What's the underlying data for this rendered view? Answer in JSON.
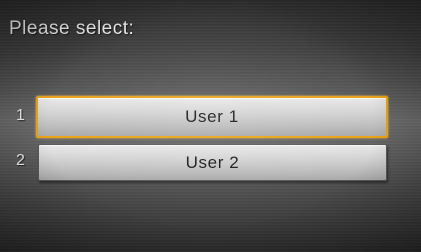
{
  "screen": {
    "title": "Please select:"
  },
  "options": [
    {
      "number": "1",
      "label": "User 1",
      "selected": true
    },
    {
      "number": "2",
      "label": "User 2",
      "selected": false
    }
  ],
  "colors": {
    "highlight": "#e8a317",
    "text_light": "#f2f2f2",
    "button_text": "#1a1a1a"
  }
}
